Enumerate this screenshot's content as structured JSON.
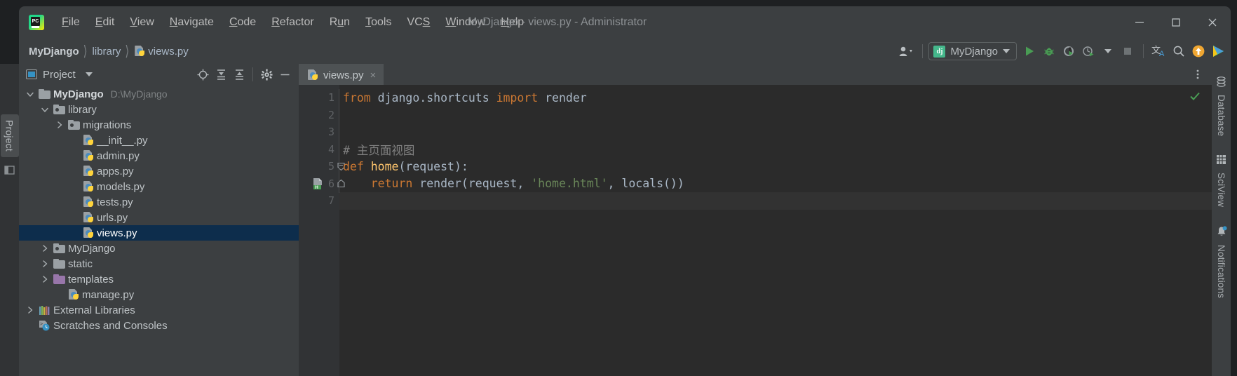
{
  "window": {
    "title": "MyDjango - views.py - Administrator",
    "logo_text": "PC",
    "controls": {
      "minimize": "minimize-button",
      "maximize": "maximize-button",
      "close": "close-button"
    }
  },
  "menubar": [
    {
      "label": "File",
      "mnemonic": "F"
    },
    {
      "label": "Edit",
      "mnemonic": "E"
    },
    {
      "label": "View",
      "mnemonic": "V"
    },
    {
      "label": "Navigate",
      "mnemonic": "N"
    },
    {
      "label": "Code",
      "mnemonic": "C"
    },
    {
      "label": "Refactor",
      "mnemonic": "R"
    },
    {
      "label": "Run",
      "mnemonic": "u"
    },
    {
      "label": "Tools",
      "mnemonic": "T"
    },
    {
      "label": "VCS",
      "mnemonic": "S"
    },
    {
      "label": "Window",
      "mnemonic": "W"
    },
    {
      "label": "Help",
      "mnemonic": "H"
    }
  ],
  "navbar": {
    "breadcrumbs": [
      {
        "label": "MyDjango",
        "icon": "none"
      },
      {
        "label": "library",
        "icon": "none"
      },
      {
        "label": "views.py",
        "icon": "python-file-icon"
      }
    ],
    "separator": "〉",
    "run_config": {
      "name": "MyDjango",
      "icon_text": "dj"
    },
    "buttons": [
      {
        "name": "user-account-button",
        "icon": "user-icon"
      },
      {
        "name": "run-button",
        "icon": "play-icon"
      },
      {
        "name": "debug-button",
        "icon": "bug-icon"
      },
      {
        "name": "run-with-coverage-button",
        "icon": "coverage-icon"
      },
      {
        "name": "profile-button",
        "icon": "profiler-icon"
      },
      {
        "name": "stop-button",
        "icon": "stop-icon"
      },
      {
        "name": "translate-button",
        "icon": "translate-icon"
      },
      {
        "name": "search-everywhere-button",
        "icon": "search-icon"
      },
      {
        "name": "update-project-button",
        "icon": "arrow-up-circle-icon"
      },
      {
        "name": "launch-button",
        "icon": "colored-play-icon"
      }
    ]
  },
  "left_stripe": {
    "tab_label": "Project",
    "extra_icon": "structure-icon"
  },
  "project_panel": {
    "title": "Project",
    "actions": [
      {
        "name": "scroll-from-source-button",
        "icon": "target-icon"
      },
      {
        "name": "expand-all-button",
        "icon": "expand-all-icon"
      },
      {
        "name": "collapse-all-button",
        "icon": "collapse-all-icon"
      },
      {
        "name": "panel-settings-button",
        "icon": "gear-icon"
      },
      {
        "name": "hide-panel-button",
        "icon": "minus-icon"
      }
    ],
    "tree": [
      {
        "label": "MyDjango",
        "path": "D:\\MyDjango",
        "icon": "folder-icon",
        "arrow": "down",
        "indent": 0,
        "root": true,
        "selected": false
      },
      {
        "label": "library",
        "path": "",
        "icon": "module-folder-icon",
        "arrow": "down",
        "indent": 1,
        "root": false,
        "selected": false
      },
      {
        "label": "migrations",
        "path": "",
        "icon": "module-folder-icon",
        "arrow": "right",
        "indent": 2,
        "root": false,
        "selected": false
      },
      {
        "label": "__init__.py",
        "path": "",
        "icon": "python-file-icon",
        "arrow": "none",
        "indent": 3,
        "root": false,
        "selected": false
      },
      {
        "label": "admin.py",
        "path": "",
        "icon": "python-file-icon",
        "arrow": "none",
        "indent": 3,
        "root": false,
        "selected": false
      },
      {
        "label": "apps.py",
        "path": "",
        "icon": "python-file-icon",
        "arrow": "none",
        "indent": 3,
        "root": false,
        "selected": false
      },
      {
        "label": "models.py",
        "path": "",
        "icon": "python-file-icon",
        "arrow": "none",
        "indent": 3,
        "root": false,
        "selected": false
      },
      {
        "label": "tests.py",
        "path": "",
        "icon": "python-file-icon",
        "arrow": "none",
        "indent": 3,
        "root": false,
        "selected": false
      },
      {
        "label": "urls.py",
        "path": "",
        "icon": "python-file-icon",
        "arrow": "none",
        "indent": 3,
        "root": false,
        "selected": false
      },
      {
        "label": "views.py",
        "path": "",
        "icon": "python-file-icon",
        "arrow": "none",
        "indent": 3,
        "root": false,
        "selected": true
      },
      {
        "label": "MyDjango",
        "path": "",
        "icon": "module-folder-icon",
        "arrow": "right",
        "indent": 1,
        "root": false,
        "selected": false
      },
      {
        "label": "static",
        "path": "",
        "icon": "folder-icon",
        "arrow": "right",
        "indent": 1,
        "root": false,
        "selected": false
      },
      {
        "label": "templates",
        "path": "",
        "icon": "purple-folder-icon",
        "arrow": "right",
        "indent": 1,
        "root": false,
        "selected": false
      },
      {
        "label": "manage.py",
        "path": "",
        "icon": "python-file-icon",
        "arrow": "none",
        "indent": 2,
        "root": false,
        "selected": false
      },
      {
        "label": "External Libraries",
        "path": "",
        "icon": "libraries-icon",
        "arrow": "right",
        "indent": 0,
        "root": false,
        "selected": false
      },
      {
        "label": "Scratches and Consoles",
        "path": "",
        "icon": "scratches-icon",
        "arrow": "none",
        "indent": 0,
        "root": false,
        "selected": false
      }
    ]
  },
  "editor": {
    "tabs": [
      {
        "label": "views.py",
        "icon": "python-file-icon",
        "active": true,
        "close": "×"
      }
    ],
    "more_actions_icon": "vertical-dots-icon",
    "inspection_status": "ok-check-icon",
    "filename": "views.py",
    "lines": [
      {
        "number": "1",
        "fold": "none",
        "gutter_icon": "none",
        "caret": false,
        "tokens": [
          {
            "t": "from",
            "c": "kw"
          },
          {
            "t": " django.shortcuts ",
            "c": "plain"
          },
          {
            "t": "import",
            "c": "kw"
          },
          {
            "t": " render",
            "c": "plain"
          }
        ]
      },
      {
        "number": "2",
        "fold": "none",
        "gutter_icon": "none",
        "caret": false,
        "tokens": []
      },
      {
        "number": "3",
        "fold": "none",
        "gutter_icon": "none",
        "caret": false,
        "tokens": []
      },
      {
        "number": "4",
        "fold": "none",
        "gutter_icon": "none",
        "caret": false,
        "tokens": [
          {
            "t": "# 主页面视图",
            "c": "comment"
          }
        ]
      },
      {
        "number": "5",
        "fold": "open",
        "gutter_icon": "none",
        "caret": false,
        "tokens": [
          {
            "t": "def",
            "c": "kw"
          },
          {
            "t": " ",
            "c": "plain"
          },
          {
            "t": "home",
            "c": "fn"
          },
          {
            "t": "(request):",
            "c": "plain"
          }
        ]
      },
      {
        "number": "6",
        "fold": "end",
        "gutter_icon": "html-file-icon",
        "caret": false,
        "tokens": [
          {
            "t": "    ",
            "c": "plain"
          },
          {
            "t": "return",
            "c": "kw"
          },
          {
            "t": " render(request, ",
            "c": "plain"
          },
          {
            "t": "'home.html'",
            "c": "str"
          },
          {
            "t": ", locals())",
            "c": "plain"
          }
        ]
      },
      {
        "number": "7",
        "fold": "none",
        "gutter_icon": "none",
        "caret": true,
        "tokens": []
      }
    ]
  },
  "right_stripe": {
    "tabs": [
      {
        "label": "Database",
        "icon": "database-icon",
        "badge": false
      },
      {
        "label": "SciView",
        "icon": "grid-icon",
        "badge": false
      },
      {
        "label": "Notifications",
        "icon": "bell-icon",
        "badge": true
      }
    ]
  },
  "colors": {
    "accent_green": "#499c54",
    "accent_orange": "#f0a732",
    "keyword": "#cc7832",
    "string": "#6a8759",
    "function": "#ffc66d",
    "plain": "#a9b7c6",
    "comment": "#808080",
    "selection": "#0d2d4c",
    "panel_bg": "#3c3f41",
    "editor_bg": "#2b2b2b"
  }
}
